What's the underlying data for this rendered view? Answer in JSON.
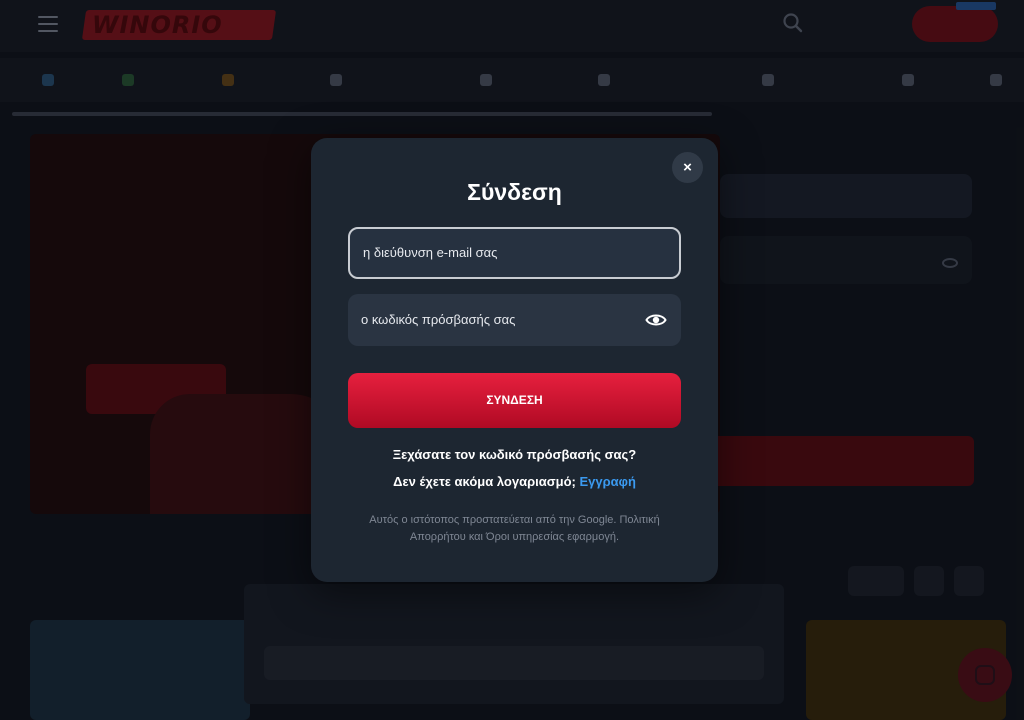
{
  "modal": {
    "title": "Σύνδεση",
    "close_label": "×",
    "email_placeholder": "η διεύθυνση e-mail σας",
    "password_placeholder": "ο κωδικός πρόσβασής σας",
    "login_button": "ΣΥΝΔΕΣΗ",
    "forgot_password": "Ξεχάσατε τον κωδικό πρόσβασής σας?",
    "no_account": "Δεν έχετε ακόμα λογαριασμό;",
    "register_link": "Εγγραφή",
    "recaptcha_notice": "Αυτός ο ιστότοπος προστατεύεται από την Google. Πολιτική Απορρήτου και Όροι υπηρεσίας εφαρμογή."
  },
  "colors": {
    "accent_red": "#e6203e",
    "link_blue": "#3b9af0",
    "modal_bg": "#1d2631"
  },
  "icons": [
    "close-icon",
    "eye-icon",
    "search-icon",
    "hamburger-icon",
    "chat-icon"
  ]
}
